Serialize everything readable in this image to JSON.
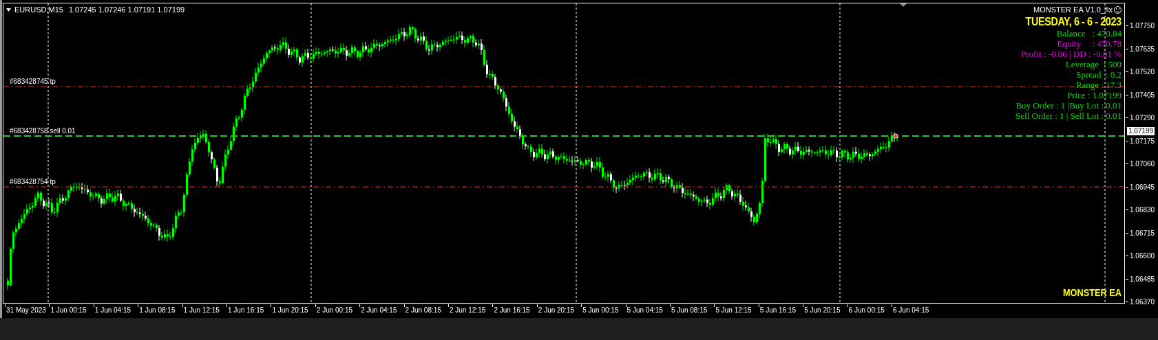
{
  "chart_header": {
    "symbol": "EURUSD,M15",
    "quotes": "1.07245 1.07246 1.07191 1.07199"
  },
  "expert_panel": {
    "title": "MONSTER EA V1.0_fix",
    "date": "TUESDAY, 6 - 6 - 2023",
    "lines": [
      {
        "text": "Balance   : 470.84",
        "color": "#00dd00"
      },
      {
        "text": "Equity     : 470.78",
        "color": "#ee00ee"
      },
      {
        "text": "Profit : -0.06 | DD : -0.01 %",
        "color": "#ee00ee"
      },
      {
        "text": "Leverage  : 500",
        "color": "#00dd00"
      },
      {
        "text": "Spread  : 0.2",
        "color": "#00dd00"
      },
      {
        "text": "Range : 17.3",
        "color": "#00dd00"
      },
      {
        "text": "Price : 1.07199",
        "color": "#00dd00"
      },
      {
        "text": "Buy Order : 1 |Buy Lot : 0.01",
        "color": "#00dd00"
      },
      {
        "text": "Sell Order : 1 | Sell Lot : 0.01",
        "color": "#00dd00"
      }
    ]
  },
  "order_lines": [
    {
      "label": "#683428745 tp",
      "kind": "tp"
    },
    {
      "label": "#683428758 sell 0.01",
      "kind": "position"
    },
    {
      "label": "#683428754 tp",
      "kind": "tp"
    }
  ],
  "brand_label": "MONSTER EA",
  "price_axis": {
    "labels": [
      "1.07750",
      "1.07635",
      "1.07520",
      "1.07405",
      "1.07290",
      "1.07175",
      "1.07060",
      "1.06945",
      "1.06830",
      "1.06715",
      "1.06600",
      "1.06485",
      "1.06370"
    ],
    "current_price": "1.07199"
  },
  "time_axis": {
    "labels": [
      "31 May 2023",
      "1 Jun 00:15",
      "1 Jun 04:15",
      "1 Jun 08:15",
      "1 Jun 12:15",
      "1 Jun 16:15",
      "1 Jun 20:15",
      "2 Jun 00:15",
      "2 Jun 04:15",
      "2 Jun 08:15",
      "2 Jun 12:15",
      "2 Jun 16:15",
      "2 Jun 20:15",
      "5 Jun 00:15",
      "5 Jun 04:15",
      "5 Jun 08:15",
      "5 Jun 12:15",
      "5 Jun 16:15",
      "5 Jun 20:15",
      "6 Jun 00:15",
      "6 Jun 04:15"
    ]
  }
}
